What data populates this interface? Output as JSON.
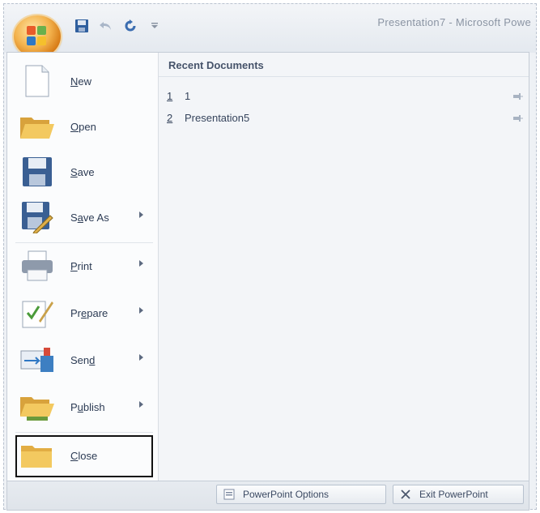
{
  "window": {
    "title": "Presentation7 - Microsoft Powe"
  },
  "quick_access": {
    "icons": [
      "save-icon",
      "undo-icon",
      "redo-icon",
      "customize-dropdown-icon"
    ]
  },
  "menu": {
    "items": [
      {
        "label": "New",
        "mnemonic": "N",
        "icon": "new-document-icon",
        "has_submenu": false
      },
      {
        "label": "Open",
        "mnemonic": "O",
        "icon": "open-folder-icon",
        "has_submenu": false
      },
      {
        "label": "Save",
        "mnemonic": "S",
        "icon": "save-icon",
        "has_submenu": false
      },
      {
        "label": "Save As",
        "mnemonic": "A",
        "icon": "save-as-icon",
        "has_submenu": true
      },
      {
        "label": "Print",
        "mnemonic": "P",
        "icon": "printer-icon",
        "has_submenu": true
      },
      {
        "label": "Prepare",
        "mnemonic": "E",
        "icon": "prepare-icon",
        "has_submenu": true
      },
      {
        "label": "Send",
        "mnemonic": "D",
        "icon": "send-icon",
        "has_submenu": true
      },
      {
        "label": "Publish",
        "mnemonic": "U",
        "icon": "publish-icon",
        "has_submenu": true
      },
      {
        "label": "Close",
        "mnemonic": "C",
        "icon": "close-folder-icon",
        "has_submenu": false
      }
    ]
  },
  "recent": {
    "header": "Recent Documents",
    "items": [
      {
        "number": "1",
        "name": "1"
      },
      {
        "number": "2",
        "name": "Presentation5"
      }
    ]
  },
  "footer": {
    "options_label": "PowerPoint Options",
    "exit_label": "Exit PowerPoint"
  },
  "colors": {
    "office_button": "#f3b24d",
    "menu_text": "#2c3b54",
    "highlight_border": "#111111"
  }
}
